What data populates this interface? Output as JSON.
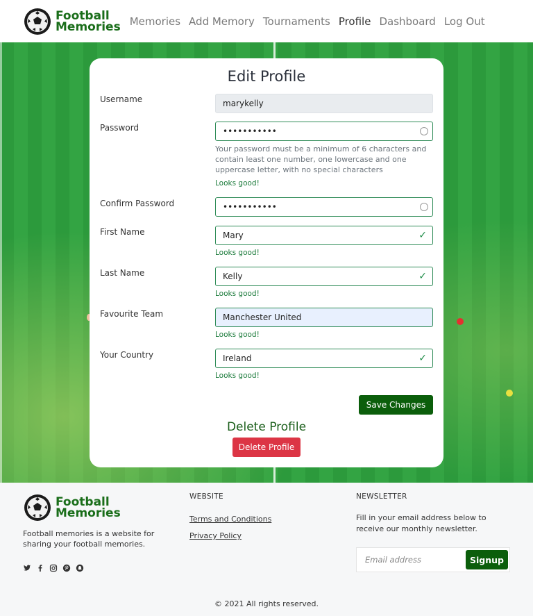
{
  "nav": {
    "logo_line1": "Football",
    "logo_line2": "Memories",
    "links": [
      {
        "label": "Memories"
      },
      {
        "label": "Add Memory"
      },
      {
        "label": "Tournaments"
      },
      {
        "label": "Profile",
        "active": true
      },
      {
        "label": "Dashboard"
      },
      {
        "label": "Log Out"
      }
    ]
  },
  "form": {
    "title": "Edit Profile",
    "username": {
      "label": "Username",
      "value": "marykelly"
    },
    "password": {
      "label": "Password",
      "value": "•••••••••••",
      "help": "Your password must be a minimum of 6 characters and contain least one number, one lowercase and one uppercase letter, with no special characters",
      "valid": "Looks good!"
    },
    "confirm_password": {
      "label": "Confirm Password",
      "value": "•••••••••••"
    },
    "first_name": {
      "label": "First Name",
      "value": "Mary",
      "valid": "Looks good!"
    },
    "last_name": {
      "label": "Last Name",
      "value": "Kelly",
      "valid": "Looks good!"
    },
    "favourite_team": {
      "label": "Favourite Team",
      "value": "Manchester United",
      "valid": "Looks good!"
    },
    "country": {
      "label": "Your Country",
      "value": "Ireland",
      "valid": "Looks good!"
    },
    "save_label": "Save Changes",
    "delete_title": "Delete Profile",
    "delete_label": "Delete Profile"
  },
  "footer": {
    "logo_line1": "Football",
    "logo_line2": "Memories",
    "description": "Football memories is a website for sharing your football memories.",
    "website_heading": "WEBSITE",
    "terms": "Terms and Conditions",
    "privacy": "Privacy Policy",
    "newsletter_heading": "NEWSLETTER",
    "newsletter_text": "Fill in your email address below to receive our monthly newsletter.",
    "email_placeholder": "Email address",
    "signup_label": "Signup",
    "copyright": "© 2021 All rights reserved.",
    "socials": [
      "twitter-icon",
      "facebook-icon",
      "instagram-icon",
      "pinterest-icon",
      "snapchat-icon"
    ]
  },
  "colors": {
    "brand_green": "#1a6e1a",
    "button_green": "#0b5e0b",
    "danger": "#dc3545",
    "valid": "#1a7a3a"
  }
}
